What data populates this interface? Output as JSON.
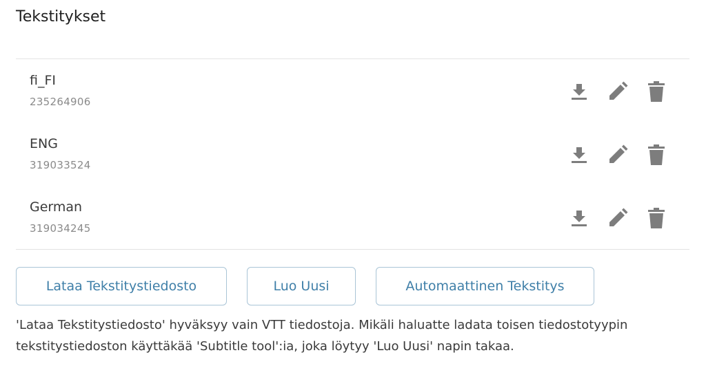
{
  "section": {
    "title": "Tekstitykset"
  },
  "subtitles": [
    {
      "language": "fi_FI",
      "id": "235264906"
    },
    {
      "language": "ENG",
      "id": "319033524"
    },
    {
      "language": "German",
      "id": "319034245"
    }
  ],
  "row_actions": {
    "download_icon": "download-icon",
    "edit_icon": "pencil-icon",
    "delete_icon": "trash-icon",
    "icon_color": "#7d7d7d"
  },
  "buttons": {
    "upload_label": "Lataa Tekstitystiedosto",
    "create_label": "Luo Uusi",
    "auto_label": "Automaattinen Tekstitys",
    "accent_color": "#3f7fa8",
    "border_color": "#a9c4d6"
  },
  "help": {
    "text": "'Lataa Tekstitystiedosto' hyväksyy vain VTT tiedostoja. Mikäli haluatte ladata toisen tiedostotyypin tekstitystiedoston käyttäkää 'Subtitle tool':ia, joka löytyy 'Luo Uusi' napin takaa."
  }
}
